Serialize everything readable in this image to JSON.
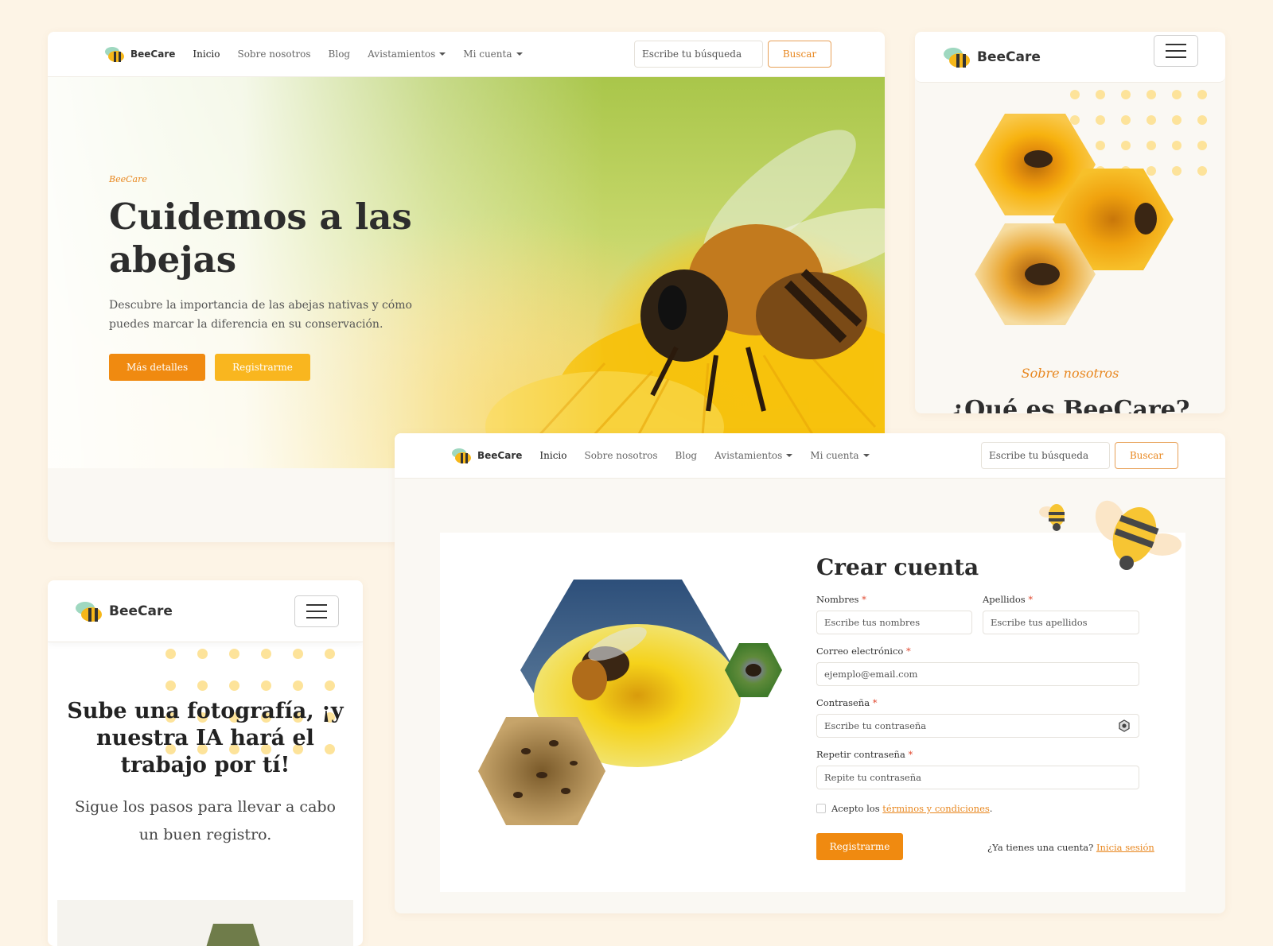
{
  "brand": "BeeCare",
  "colors": {
    "accent": "#f08a10",
    "yellow": "#f9b61f",
    "background": "#fdf4e6",
    "dots": "#fde39a"
  },
  "nav": {
    "items": [
      {
        "label": "Inicio",
        "active": true
      },
      {
        "label": "Sobre nosotros"
      },
      {
        "label": "Blog"
      },
      {
        "label": "Avistamientos",
        "dropdown": true
      },
      {
        "label": "Mi cuenta",
        "dropdown": true
      }
    ],
    "search_placeholder": "Escribe tu búsqueda",
    "search_button": "Buscar"
  },
  "hero": {
    "eyebrow": "BeeCare",
    "title": "Cuidemos a las abejas",
    "description": "Descubre la importancia de las abejas nativas y cómo puedes marcar la diferencia en su conservación.",
    "primary_button": "Más detalles",
    "secondary_button": "Registrarme"
  },
  "mobile_top": {
    "section_label": "Sobre nosotros",
    "section_title_cut": "¿Qué es BeeCare?"
  },
  "mobile_bottom": {
    "title": "Sube una fotografía, ¡y nuestra IA hará el trabajo por tí!",
    "description": "Sigue los pasos para llevar a cabo un buen registro."
  },
  "signup": {
    "title": "Crear cuenta",
    "fields": {
      "first_name": {
        "label": "Nombres",
        "placeholder": "Escribe tus nombres"
      },
      "last_name": {
        "label": "Apellidos",
        "placeholder": "Escribe tus apellidos"
      },
      "email": {
        "label": "Correo electrónico",
        "placeholder": "ejemplo@email.com"
      },
      "password": {
        "label": "Contraseña",
        "placeholder": "Escribe tu contraseña"
      },
      "password_repeat": {
        "label": "Repetir contraseña",
        "placeholder": "Repite tu contraseña"
      }
    },
    "required_mark": "*",
    "terms_prefix": "Acepto los",
    "terms_link": "términos y condiciones",
    "terms_suffix": ".",
    "submit": "Registrarme",
    "have_account": "¿Ya tienes una cuenta?",
    "signin_link": "Inicia sesión"
  }
}
